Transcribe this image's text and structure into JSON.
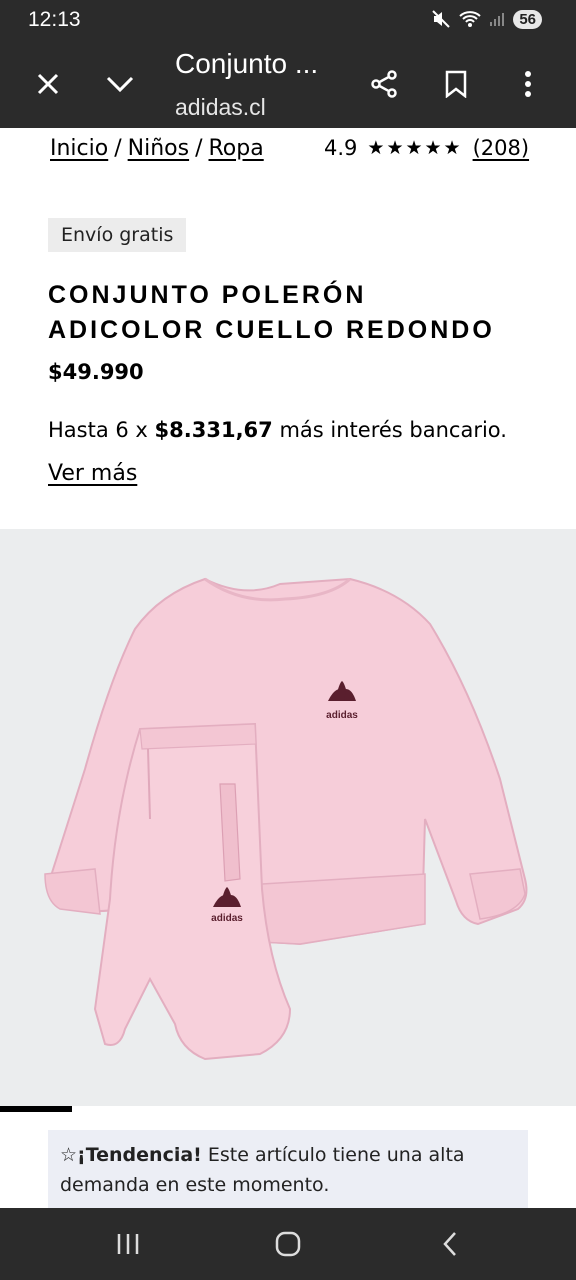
{
  "status": {
    "time": "12:13",
    "battery": "56"
  },
  "browser": {
    "tab_title": "Conjunto ...",
    "url": "adidas.cl"
  },
  "breadcrumb": [
    "Inicio",
    "Niños",
    "Ropa"
  ],
  "rating": {
    "score": "4.9",
    "stars": "★★★★★",
    "count": "(208)"
  },
  "badge": "Envío gratis",
  "product": {
    "title": "CONJUNTO POLERÓN ADICOLOR CUELLO REDONDO",
    "price": "$49.990",
    "installments_prefix": "Hasta 6 x ",
    "installments_amount": "$8.331,67",
    "installments_suffix": " más interés bancario.",
    "more_link": "Ver más"
  },
  "image": {
    "logo_text": "adidas",
    "progress": 0.125,
    "colors": {
      "background": "#ebedee",
      "garment": "#f6cdd9",
      "logo": "#5a1f2e"
    }
  },
  "trend": {
    "icon": "sparkle-icon",
    "label": "¡Tendencia!",
    "text": " Este artículo tiene una alta demanda en este momento."
  }
}
